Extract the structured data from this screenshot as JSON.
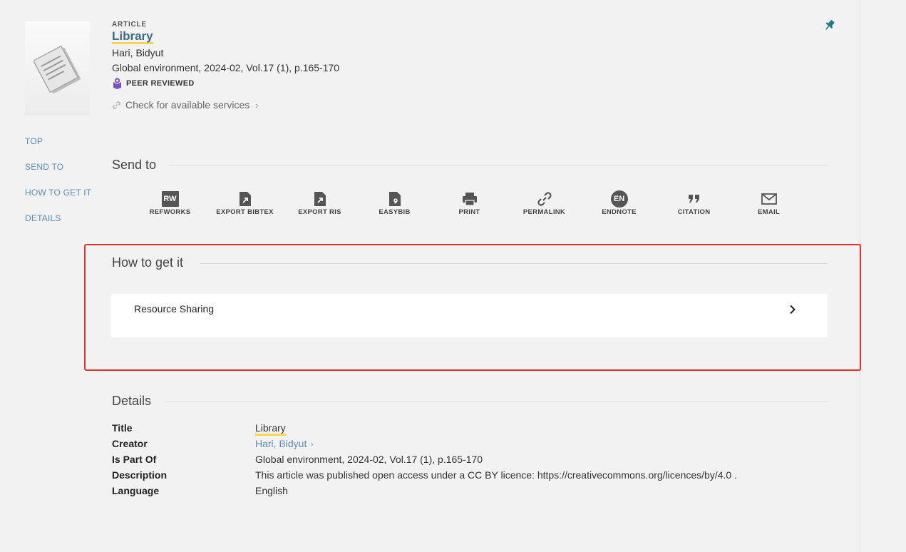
{
  "record": {
    "type": "ARTICLE",
    "title": "Library",
    "creator": "Hari, Bidyut",
    "is_part_of": "Global environment, 2024-02, Vol.17 (1), p.165-170",
    "peer_reviewed": "PEER REVIEWED",
    "check_services": "Check for available services"
  },
  "sidenav": {
    "items": [
      "TOP",
      "SEND TO",
      "HOW TO GET IT",
      "DETAILS"
    ]
  },
  "send_to": {
    "heading": "Send to",
    "items": [
      {
        "label": "REFWORKS",
        "icon": "refworks-icon",
        "badge": "RW"
      },
      {
        "label": "EXPORT BIBTEX",
        "icon": "export-bibtex-icon"
      },
      {
        "label": "EXPORT RIS",
        "icon": "export-ris-icon"
      },
      {
        "label": "EASYBIB",
        "icon": "easybib-icon"
      },
      {
        "label": "PRINT",
        "icon": "print-icon"
      },
      {
        "label": "PERMALINK",
        "icon": "link-icon"
      },
      {
        "label": "ENDNOTE",
        "icon": "endnote-icon",
        "badge": "EN"
      },
      {
        "label": "CITATION",
        "icon": "quote-icon"
      },
      {
        "label": "EMAIL",
        "icon": "email-icon"
      }
    ]
  },
  "how_to_get": {
    "heading": "How to get it",
    "resource_sharing": "Resource Sharing"
  },
  "details": {
    "heading": "Details",
    "title_key": "Title",
    "title_val": "Library",
    "creator_key": "Creator",
    "creator_val": "Hari, Bidyut",
    "ispart_key": "Is Part Of",
    "ispart_val": "Global environment, 2024-02, Vol.17 (1), p.165-170",
    "desc_key": "Description",
    "desc_val": "This article was published open access under a CC BY licence: https://creativecommons.org/licences/by/4.0 .",
    "lang_key": "Language",
    "lang_val": "English"
  },
  "colors": {
    "accent_link": "#5b8db8",
    "title_underline": "#f6d55c",
    "highlight_border": "#e8302a",
    "pin": "#1f7a7a",
    "peer_badge": "#7b4fc9"
  }
}
